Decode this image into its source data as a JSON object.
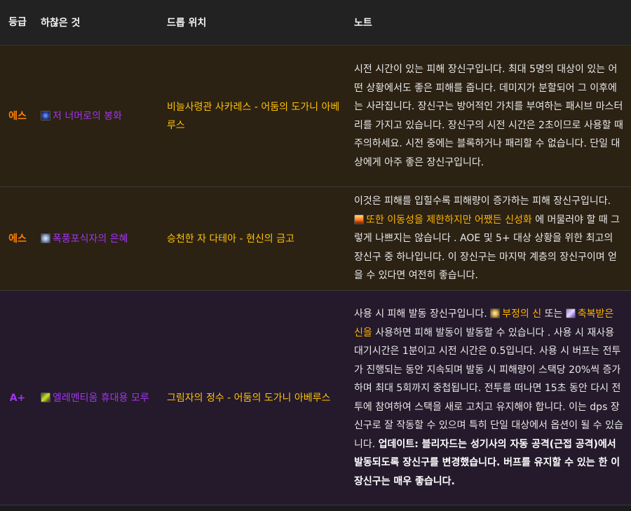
{
  "headers": {
    "grade": "등급",
    "trinket": "하찮은 것",
    "drop": "드롭 위치",
    "note": "노트"
  },
  "rows": [
    {
      "grade": "에스",
      "trinket": "저 너머로의 봉화",
      "trinket_icon": "beacon-gaze-icon",
      "drop": "비늘사령관 사카레스 - 어둠의 도가니 아베루스",
      "note": "시전 시간이 있는 피해 장신구입니다. 최대 5명의 대상이 있는 어떤 상황에서도 좋은 피해를 줍니다. 데미지가 분할되어 그 이후에는 사라집니다. 장신구는 방어적인 가치를 부여하는 패시브 마스터리를 가지고 있습니다. 장신구의 시전 시간은 2초이므로 사용할 때 주의하세요. 시전 중에는 블록하거나 패리할 수 없습니다. 단일 대상에게 아주 좋은 장신구입니다."
    },
    {
      "grade": "에스",
      "trinket": "폭풍포식자의 은혜",
      "trinket_icon": "stormeater-icon",
      "drop": "승천한 자 다테아 - 현신의 금고",
      "note_before": "이것은 피해를 입힐수록 피해량이 증가하는 피해 장신구입니다. ",
      "note_link": "또한 이동성을 제한하지만 어쨌든 신성화",
      "note_link_icon": "consecration-fire-icon",
      "note_after": " 에 머물러야 할 때 그렇게 나쁘지는 않습니다 . AOE 및 5+ 대상 상황을 위한 최고의 장신구 중 하나입니다. 이 장신구는 마지막 계층의 장신구이며 얻을 수 있다면 여전히 좋습니다."
    },
    {
      "grade": "A+",
      "trinket": "엘레멘티움 휴대용 모루",
      "trinket_icon": "elementium-anvil-icon",
      "drop": "그림자의 정수 - 어둠의 도가니 아베루스",
      "note_p1": "사용 시 피해 발동 장신구입니다. ",
      "note_link1": "부정의 신",
      "note_link1_icon": "unholy-god-icon",
      "note_p2": " 또는 ",
      "note_link2": "축복받은 신을",
      "note_link2_icon": "blessed-god-icon",
      "note_p3": " 사용하면 피해 발동이 발동할 수 있습니다 . 사용 시 재사용 대기시간은 1분이고 시전 시간은 0.5입니다. 사용 시 버프는 전투가 진행되는 동안 지속되며 발동 시 피해량이 스택당 20%씩 증가하며 최대 5회까지 중첩됩니다. 전투를 떠나면 15초 동안 다시 전투에 참여하여 스택을 새로 고치고 유지해야 합니다. 이는 dps 장신구로 잘 작동할 수 있으며 특히 단일 대상에서 옵션이 될 수 있습니다. ",
      "note_bold": "업데이트: 블리자드는 성기사의 자동 공격(근접 공격)에서 발동되도록 장신구를 변경했습니다. 버프를 유지할 수 있는 한 이 장신구는 매우 좋습니다."
    }
  ],
  "colors": {
    "grade_s": "#ff8000",
    "grade_a_plus": "#a335ee",
    "trinket_epic": "#a335ee",
    "drop_location": "#ffc107",
    "highlight": "#ffb300"
  }
}
